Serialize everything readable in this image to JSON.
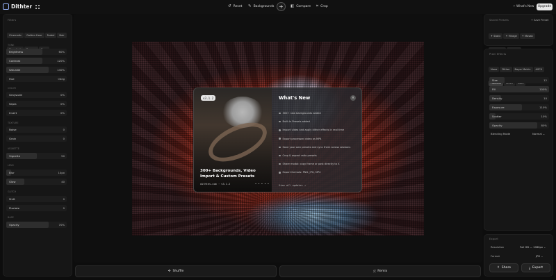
{
  "app": {
    "name": "Dithter"
  },
  "topbar": {
    "reset": "Reset",
    "backgrounds": "Backgrounds",
    "compare": "Compare",
    "crop": "Crop",
    "whats_new": "What's New",
    "upgrade": "Upgrade"
  },
  "left": {
    "filters_title": "Filters",
    "filters": [
      "Cinematic",
      "Golden Hour",
      "Faded",
      "Noir",
      "Moonlight",
      "Dreamy",
      "Neon"
    ],
    "tone_title": "TONE",
    "tone": [
      {
        "label": "Brightness",
        "value": "60%",
        "fill": 0.6
      },
      {
        "label": "Contrast",
        "value": "120%",
        "fill": 0.6
      },
      {
        "label": "Saturate",
        "value": "140%",
        "fill": 0.7
      },
      {
        "label": "Hue",
        "value": "0deg",
        "fill": 0
      }
    ],
    "color_title": "COLOR",
    "color": [
      {
        "label": "Grayscale",
        "value": "0%",
        "fill": 0
      },
      {
        "label": "Sepia",
        "value": "0%",
        "fill": 0
      },
      {
        "label": "Invert",
        "value": "0%",
        "fill": 0
      }
    ],
    "texture_title": "TEXTURE",
    "texture": [
      {
        "label": "Noise",
        "value": "0",
        "fill": 0
      },
      {
        "label": "Grain",
        "value": "0",
        "fill": 0
      }
    ],
    "vignette_title": "VIGNETTE",
    "vignette": [
      {
        "label": "Vignette",
        "value": "50",
        "fill": 0.5
      }
    ],
    "lens_title": "LENS",
    "lens": [
      {
        "label": "Blur",
        "value": "14px",
        "fill": 0.08
      },
      {
        "label": "Glow",
        "value": "40",
        "fill": 0.3
      }
    ],
    "glitch_title": "GLITCH",
    "glitch": [
      {
        "label": "Shift",
        "value": "0",
        "fill": 0
      },
      {
        "label": "Pixelate",
        "value": "0",
        "fill": 0
      }
    ],
    "base_title": "BASE",
    "base": [
      {
        "label": "Opacity",
        "value": "70%",
        "fill": 0.7
      }
    ]
  },
  "right": {
    "saved_title": "Saved Presets",
    "save_preset": "Save Preset",
    "presets": [
      "Static",
      "Mirage",
      "Mosaic",
      "Terminal",
      "Glitch"
    ],
    "show_all": "Show all",
    "pixel_title": "Pixel Effects",
    "effects": [
      "None",
      "Dither",
      "Bayer Matrix",
      "ASCII",
      "Halftone",
      "LEGO",
      "Dots"
    ],
    "active_effect": "Halftone",
    "params": [
      {
        "label": "Size",
        "value": "12",
        "fill": 0.25
      },
      {
        "label": "Fill",
        "value": "100%",
        "fill": 1.0
      },
      {
        "label": "Density",
        "value": "10",
        "fill": 0.2
      },
      {
        "label": "Exposure",
        "value": "110%",
        "fill": 0.55
      },
      {
        "label": "Scatter",
        "value": "10%",
        "fill": 0.1
      },
      {
        "label": "Opacity",
        "value": "80%",
        "fill": 0.8
      }
    ],
    "blend_label": "Blending Mode",
    "blend_value": "Normal",
    "export_title": "Export",
    "resolution_label": "Resolution",
    "resolution_value": "Full HD — 1080px",
    "format_label": "Format",
    "format_value": "JPG",
    "share": "Share",
    "export": "Export"
  },
  "modal": {
    "version_badge": "v3.1.2",
    "headline": "300+ Backgrounds, Video Import & Custom Presets",
    "footer": "dithtes.com · v3.1.2",
    "title": "What's New",
    "items": [
      "300+ new backgrounds added",
      "Built-In Presets added",
      "Import video and apply dither effects in real time",
      "Export processed video as MP4",
      "Save your own presets and sync them across sessions",
      "Crop & aspect ratio presets",
      "Share modal: copy frame or post directly to X",
      "Export formats: PNG, JPG, MP4"
    ],
    "view_all": "View all updates →"
  },
  "bottom": {
    "shuffle": "Shuffle",
    "remix": "Remix"
  }
}
